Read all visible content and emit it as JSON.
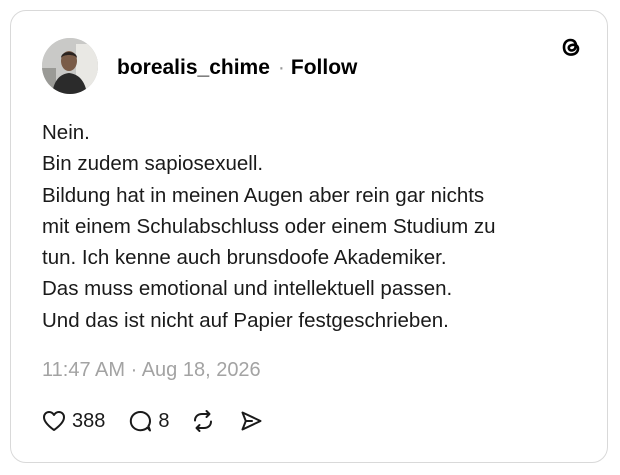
{
  "post": {
    "username": "borealis_chime",
    "separator": "·",
    "follow_label": "Follow",
    "body_lines": [
      "Nein.",
      "Bin zudem sapiosexuell.",
      "Bildung hat in meinen Augen aber rein gar nichts",
      "mit einem Schulabschluss oder einem Studium zu",
      "tun. Ich kenne auch brunsdoofe Akademiker.",
      "Das muss emotional und intellektuell passen.",
      "Und das ist nicht auf Papier festgeschrieben."
    ],
    "timestamp": "11:47 AM · Aug 18, 2026"
  },
  "actions": {
    "like_count": "388",
    "reply_count": "8"
  },
  "icons": {
    "brand": "threads-logo-icon",
    "like": "heart-icon",
    "reply": "speech-bubble-icon",
    "repost": "repost-icon",
    "share": "send-icon"
  },
  "colors": {
    "text": "#1a1a1a",
    "muted": "#a3a3a3",
    "border": "#d9d9d9"
  }
}
